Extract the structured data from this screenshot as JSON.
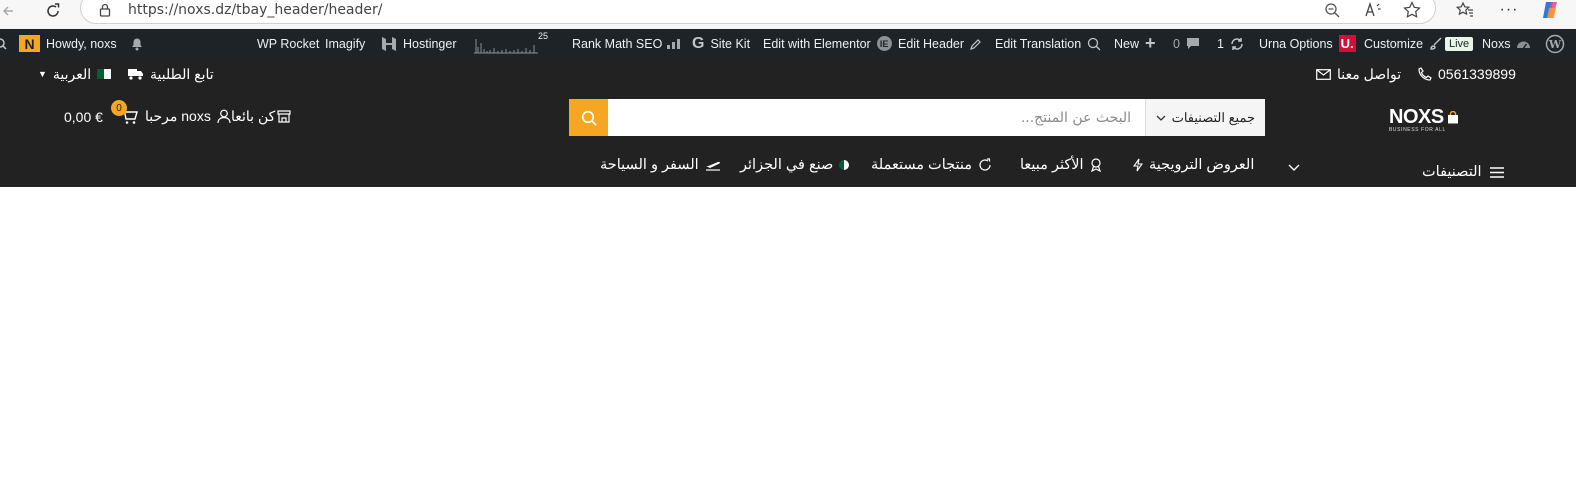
{
  "browser": {
    "url": "https://noxs.dz/tbay_header/header/",
    "icons": [
      "back-icon",
      "refresh-icon",
      "lock-icon",
      "zoom-icon",
      "read-aloud-icon",
      "favorite-icon",
      "favorites-list-icon",
      "more-icon",
      "copilot-icon"
    ]
  },
  "adminbar": {
    "howdy": "Howdy, noxs",
    "wp_rocket": "WP Rocket",
    "imagify": "Imagify",
    "hostinger": "Hostinger",
    "stats_count": "25",
    "rank_math": "Rank Math SEO",
    "site_kit": "Site Kit",
    "edit_elementor": "Edit with Elementor",
    "edit_header": "Edit Header",
    "edit_translation": "Edit Translation",
    "new": "New",
    "comments_count": "0",
    "updates_count": "1",
    "urna_options": "Urna Options",
    "customize": "Customize",
    "live": "Live",
    "site_name": "Noxs"
  },
  "header": {
    "language": "العربية",
    "track_order": "تابع الطلبية",
    "contact": "تواصل معنا",
    "phone": "0561339899",
    "logo_text": "NOXS",
    "logo_tagline": "BUSINESS FOR ALL",
    "search_placeholder": "البحث عن المنتج...",
    "category_select": "جميع التصنيفات",
    "cart_total": "0,00 €",
    "cart_count": "0",
    "welcome": "مرحبا noxs",
    "become_seller": "كن بائعا",
    "categories_label": "التصنيفات",
    "menu": [
      {
        "label": "العروض الترويجية",
        "icon": "flash-icon"
      },
      {
        "label": "الأكثر مبيعا",
        "icon": "award-icon"
      },
      {
        "label": "منتجات مستعملة",
        "icon": "recycle-icon"
      },
      {
        "label": "صنع في الجزائر",
        "icon": "algeria-flag-icon"
      },
      {
        "label": "السفر و السياحة",
        "icon": "plane-icon"
      }
    ]
  },
  "colors": {
    "adminbar_bg": "#1d2327",
    "header_bg": "#222222",
    "accent": "#f5a623"
  }
}
